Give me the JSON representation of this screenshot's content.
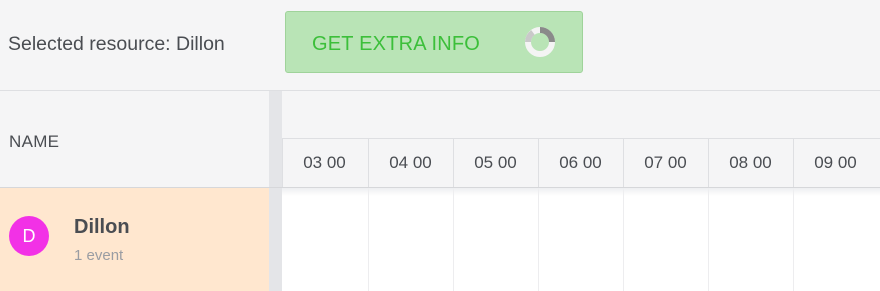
{
  "toolbar": {
    "selected_text": "Selected resource: Dillon",
    "extra_info_button": "GET EXTRA INFO",
    "spinner_icon": "loading-spinner-icon"
  },
  "grid": {
    "name_header": "NAME",
    "time_columns": [
      "03 00",
      "04 00",
      "05 00",
      "06 00",
      "07 00",
      "08 00",
      "09 00"
    ]
  },
  "resources": [
    {
      "initial": "D",
      "name": "Dillon",
      "events": "1 event",
      "avatar_color": "#f231e6",
      "selected": true
    }
  ],
  "colors": {
    "selected_row": "#ffe7cf",
    "button_bg": "#b9e4b6",
    "button_text": "#3cbf3a"
  }
}
